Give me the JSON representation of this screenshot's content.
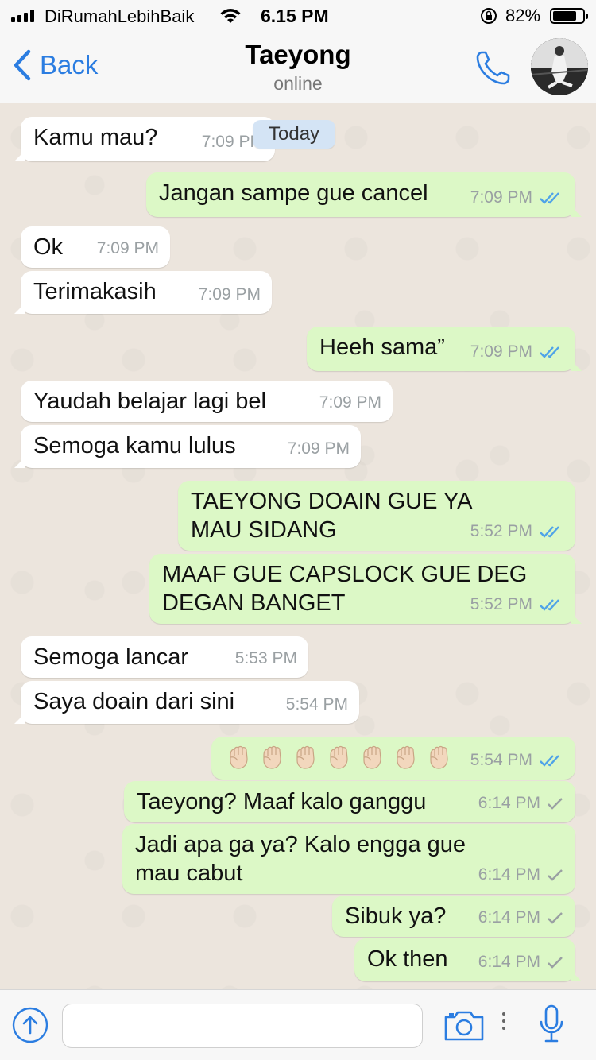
{
  "status_bar": {
    "carrier": "DiRumahLebihBaik",
    "time": "6.15 PM",
    "battery_percent": "82%",
    "battery_level": 0.82
  },
  "nav": {
    "back_label": "Back",
    "contact_name": "Taeyong",
    "contact_status": "online"
  },
  "date_badge": "Today",
  "messages": [
    {
      "dir": "in",
      "text": "Kamu mau?",
      "time": "7:09 PM"
    },
    {
      "dir": "out",
      "text": "Jangan sampe gue cancel",
      "time": "7:09 PM",
      "ticks": "read"
    },
    {
      "dir": "in",
      "text": "Ok",
      "time": "7:09 PM"
    },
    {
      "dir": "in",
      "text": "Terimakasih",
      "time": "7:09 PM"
    },
    {
      "dir": "out",
      "text": "Heeh sama”",
      "time": "7:09 PM",
      "ticks": "read"
    },
    {
      "dir": "in",
      "text": "Yaudah belajar lagi bel",
      "time": "7:09 PM"
    },
    {
      "dir": "in",
      "text": "Semoga kamu lulus",
      "time": "7:09 PM"
    },
    {
      "dir": "out",
      "text": "TAEYONG DOAIN GUE YA\nMAU SIDANG",
      "time": "5:52 PM",
      "ticks": "read"
    },
    {
      "dir": "out",
      "text": "MAAF GUE CAPSLOCK GUE DEG\nDEGAN BANGET",
      "time": "5:52 PM",
      "ticks": "read"
    },
    {
      "dir": "in",
      "text": "Semoga lancar",
      "time": "5:53 PM"
    },
    {
      "dir": "in",
      "text": "Saya doain dari sini",
      "time": "5:54 PM"
    },
    {
      "dir": "out",
      "text": "",
      "emoji_count": 7,
      "emoji_icon": "raised-fist-icon",
      "time": "5:54 PM",
      "ticks": "read"
    },
    {
      "dir": "out",
      "text": "Taeyong? Maaf kalo ganggu",
      "time": "6:14 PM",
      "ticks": "delivered"
    },
    {
      "dir": "out",
      "text": "Jadi apa ga ya? Kalo engga gue\nmau cabut",
      "time": "6:14 PM",
      "ticks": "delivered"
    },
    {
      "dir": "out",
      "text": "Sibuk ya?",
      "time": "6:14 PM",
      "ticks": "delivered"
    },
    {
      "dir": "out",
      "text": "Ok then",
      "time": "6:14 PM",
      "ticks": "delivered"
    }
  ],
  "input": {
    "value": "",
    "placeholder": ""
  },
  "colors": {
    "accent": "#2b7de1",
    "outgoing_bubble": "#dcf8c6",
    "incoming_bubble": "#ffffff",
    "read_tick": "#4fa3e8",
    "delivered_tick": "#9aa0a3",
    "chat_background": "#ece5dd"
  },
  "icons": {
    "back": "chevron-left-icon",
    "call": "phone-icon",
    "attach": "upload-arrow-icon",
    "camera": "camera-icon",
    "mic": "microphone-icon"
  }
}
